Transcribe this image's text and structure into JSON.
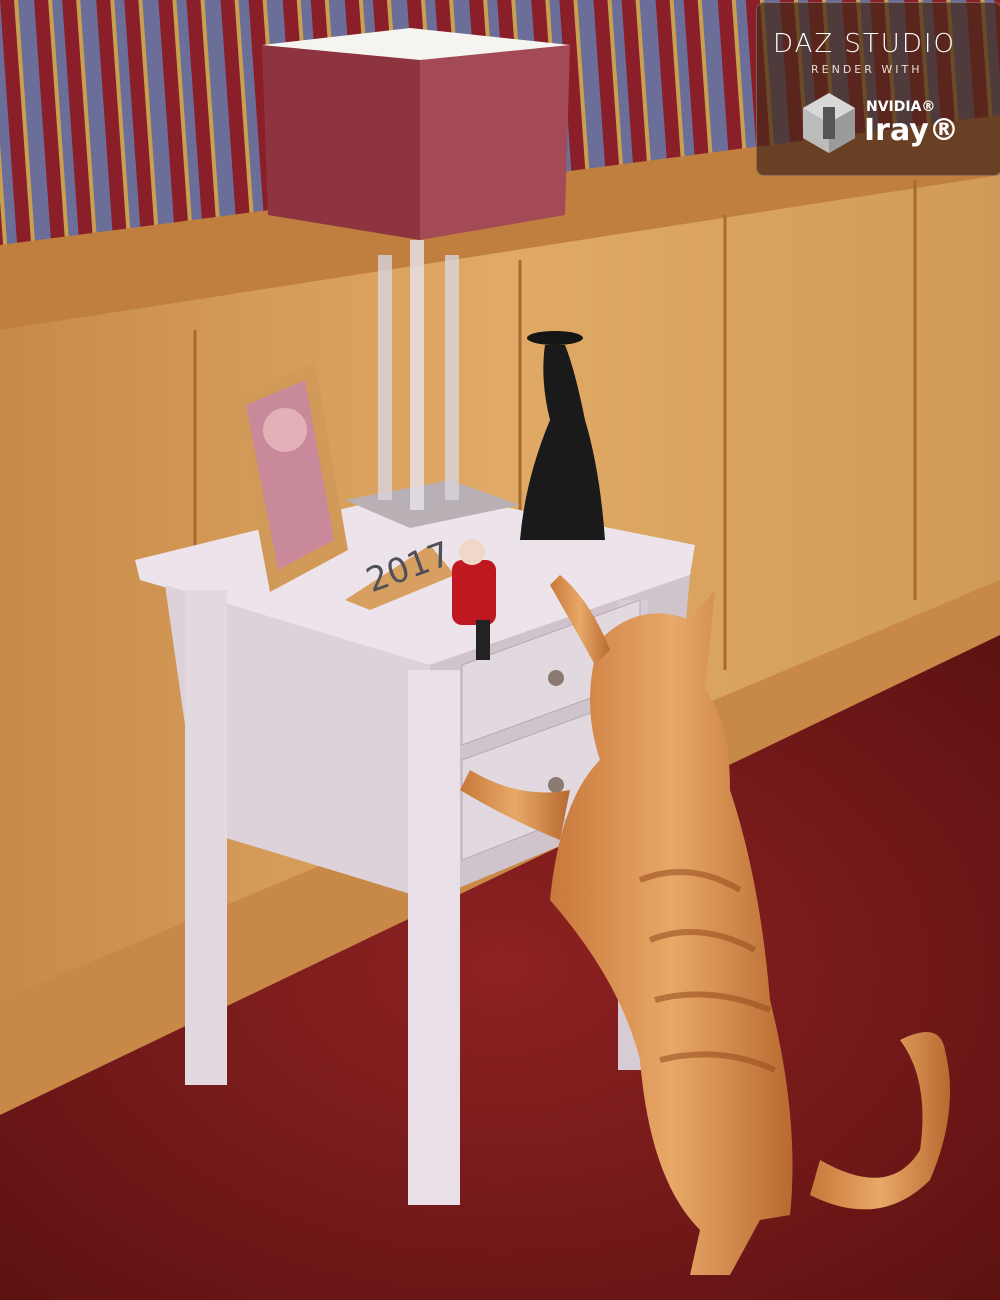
{
  "logo": {
    "brand": "DAZ STUDIO",
    "tagline": "RENDER WITH",
    "vendor": "NVIDIA®",
    "product": "Iray®"
  },
  "colors": {
    "wallpaper_red": "#8a1f2a",
    "wallpaper_blue": "#6a6e98",
    "wood_panel": "#d49a55",
    "carpet": "#7a1a1a",
    "table": "#e6dde4",
    "lampshade": "#9a3c48",
    "cat": "#d98a45"
  }
}
